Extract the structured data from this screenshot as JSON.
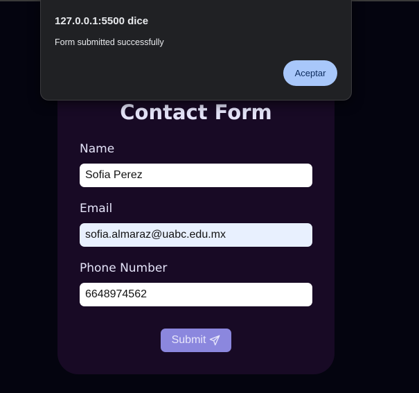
{
  "alert": {
    "origin": "127.0.0.1:5500 dice",
    "message": "Form submitted successfully",
    "accept_label": "Aceptar"
  },
  "form": {
    "title": "Contact Form",
    "fields": [
      {
        "label": "Name",
        "value": "Sofia Perez"
      },
      {
        "label": "Email",
        "value": "sofia.almaraz@uabc.edu.mx"
      },
      {
        "label": "Phone Number",
        "value": "6648974562"
      }
    ],
    "submit_label": "Submit",
    "submit_icon": "paper-plane-icon"
  },
  "colors": {
    "page_background": "#04040f",
    "card_background": "#180a25",
    "submit_button": "#8b87de",
    "alert_background": "#202124",
    "alert_accept_button": "#a8c7fa",
    "autofill_background": "#e8f0fe"
  }
}
